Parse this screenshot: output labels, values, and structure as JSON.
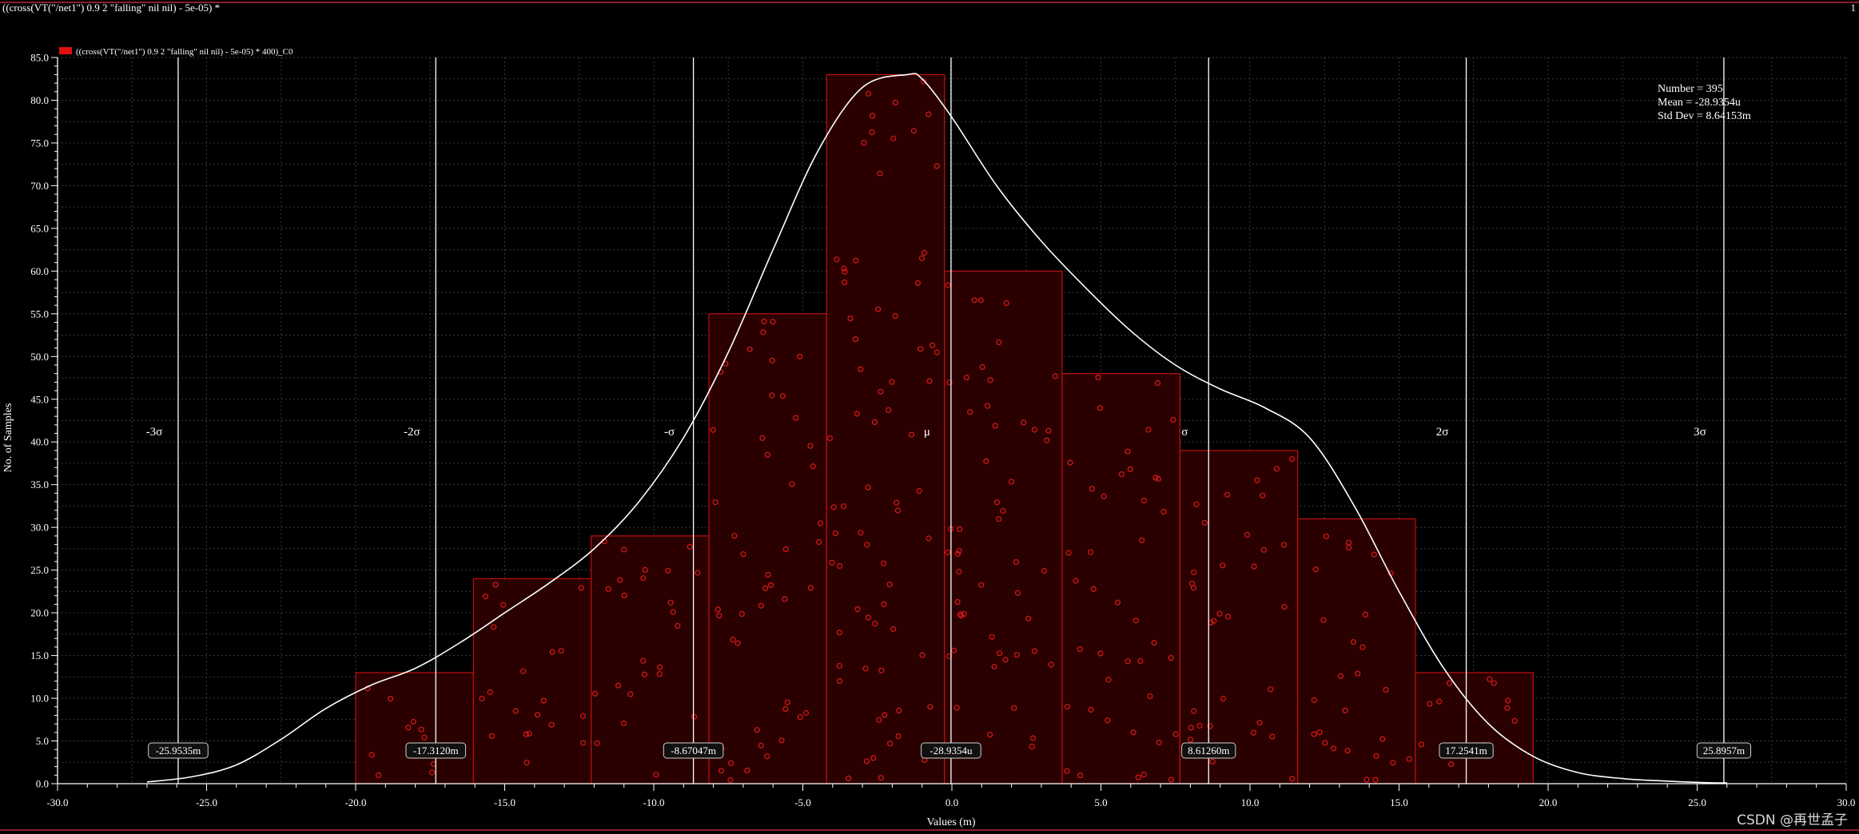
{
  "window": {
    "title": "((cross(VT(\"/net1\") 0.9 2 \"falling\" nil nil) - 5e-05) *",
    "corner_label": "1"
  },
  "watermark": "CSDN @再世孟子",
  "colors": {
    "background": "#000000",
    "bar_fill": "#2a0000",
    "bar_edge": "#c01010",
    "points": "#e01818",
    "curve": "#ffffff",
    "sigma_lines": "#ffffff",
    "legend_swatch": "#e01010",
    "frame_accent": "#8a1f2a"
  },
  "chart_data": {
    "type": "bar",
    "subtype": "histogram-with-density",
    "legend": [
      {
        "label": "((cross(VT(\"/net1\") 0.9 2 \"falling\" nil nil) - 5e-05) * 400)_C0",
        "color": "#e01010"
      }
    ],
    "legend_placement": "top-left",
    "xlabel": "Values (m)",
    "ylabel": "No. of Samples",
    "xlim": [
      -30,
      30
    ],
    "ylim": [
      0,
      85
    ],
    "grid": true,
    "xticks": [
      -30,
      -25,
      -20,
      -15,
      -10,
      -5,
      0,
      5,
      10,
      15,
      20,
      25,
      30
    ],
    "xtick_labels": [
      "-30.0",
      "-25.0",
      "-20.0",
      "-15.0",
      "-10.0",
      "-5.0",
      "0.0",
      "5.0",
      "10.0",
      "15.0",
      "20.0",
      "25.0",
      "30.0"
    ],
    "yticks": [
      0,
      5,
      10,
      15,
      20,
      25,
      30,
      35,
      40,
      45,
      50,
      55,
      60,
      65,
      70,
      75,
      80,
      85
    ],
    "ytick_labels": [
      "0.0",
      "5.0",
      "10.0",
      "15.0",
      "20.0",
      "25.0",
      "30.0",
      "35.0",
      "40.0",
      "45.0",
      "50.0",
      "55.0",
      "60.0",
      "65.0",
      "70.0",
      "75.0",
      "80.0",
      "85.0"
    ],
    "bins": [
      {
        "x0": -20.0,
        "x1": -16.05,
        "count": 13
      },
      {
        "x0": -16.05,
        "x1": -12.1,
        "count": 24
      },
      {
        "x0": -12.1,
        "x1": -8.15,
        "count": 29
      },
      {
        "x0": -8.15,
        "x1": -4.2,
        "count": 55
      },
      {
        "x0": -4.2,
        "x1": -0.25,
        "count": 83
      },
      {
        "x0": -0.25,
        "x1": 3.7,
        "count": 60
      },
      {
        "x0": 3.7,
        "x1": 7.65,
        "count": 48
      },
      {
        "x0": 7.65,
        "x1": 11.6,
        "count": 39
      },
      {
        "x0": 11.6,
        "x1": 15.55,
        "count": 31
      },
      {
        "x0": 15.55,
        "x1": 19.5,
        "count": 13
      }
    ],
    "density_curve": {
      "x": [
        -27,
        -25.5,
        -24,
        -22.5,
        -21,
        -19.5,
        -18,
        -16.5,
        -15,
        -13.5,
        -12,
        -10.5,
        -9,
        -7.5,
        -6,
        -4.5,
        -3,
        -1.5,
        -1,
        0,
        1.5,
        3,
        4.5,
        6,
        7.5,
        9,
        10.5,
        12,
        13.5,
        15,
        16.5,
        18,
        19.5,
        21,
        22.5,
        24,
        25.5,
        26
      ],
      "y": [
        0.2,
        0.8,
        2.2,
        5.2,
        8.8,
        11.5,
        13.5,
        16.5,
        20,
        23.5,
        27.5,
        33,
        40.5,
        50.5,
        62.5,
        74,
        81.5,
        83,
        82.5,
        78,
        70,
        63.5,
        58,
        53,
        49,
        46.2,
        44,
        40.5,
        32.5,
        22.5,
        13.5,
        7,
        3.2,
        1.3,
        0.6,
        0.3,
        0.1,
        0.1
      ]
    },
    "sigma_markers": [
      {
        "symbol": "-3σ",
        "value": -25.9535,
        "value_label": "-25.9535m"
      },
      {
        "symbol": "-2σ",
        "value": -17.312,
        "value_label": "-17.3120m"
      },
      {
        "symbol": "-σ",
        "value": -8.67047,
        "value_label": "-8.67047m"
      },
      {
        "symbol": "μ",
        "value": -0.0289354,
        "value_label": "-28.9354u"
      },
      {
        "symbol": "σ",
        "value": 8.6126,
        "value_label": "8.61260m"
      },
      {
        "symbol": "2σ",
        "value": 17.2541,
        "value_label": "17.2541m"
      },
      {
        "symbol": "3σ",
        "value": 25.8957,
        "value_label": "25.8957m"
      }
    ],
    "stats": {
      "number": "Number = 395",
      "mean": "Mean = -28.9354u",
      "std_dev": "Std Dev = 8.64153m"
    }
  }
}
